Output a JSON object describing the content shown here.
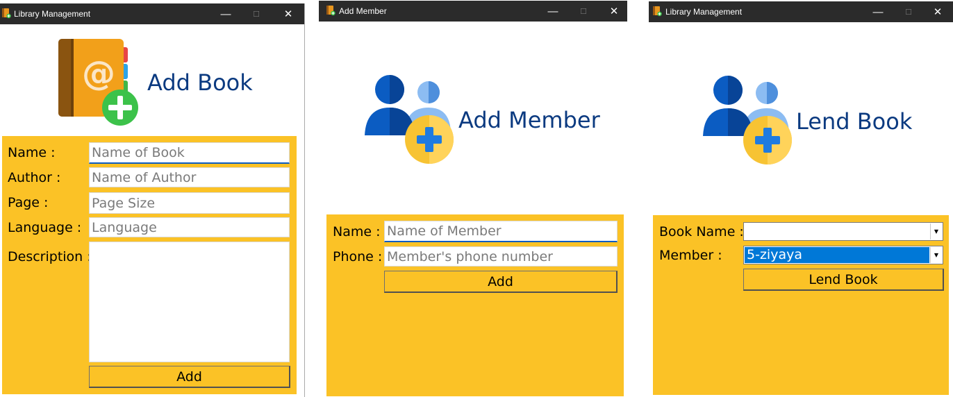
{
  "windows": {
    "add_book": {
      "title": "Library Management",
      "heading": "Add Book",
      "labels": {
        "name": "Name :",
        "author": "Author :",
        "page": "Page :",
        "language": "Language :",
        "description": "Description :"
      },
      "placeholders": {
        "name": "Name of Book",
        "author": "Name of Author",
        "page": "Page Size",
        "language": "Language"
      },
      "add_button": "Add"
    },
    "add_member": {
      "title": "Add Member",
      "heading": "Add Member",
      "labels": {
        "name": "Name :",
        "phone": "Phone :"
      },
      "placeholders": {
        "name": "Name of Member",
        "phone": "Member's phone number"
      },
      "add_button": "Add"
    },
    "lend_book": {
      "title": "Library Management",
      "heading": "Lend Book",
      "labels": {
        "book_name": "Book Name :",
        "member": "Member :"
      },
      "book_name_value": "",
      "member_value": "5-ziyaya",
      "lend_button": "Lend Book"
    }
  },
  "window_controls": {
    "minimize": "—",
    "maximize": "☐",
    "close": "✕"
  },
  "colors": {
    "panel": "#fbc226",
    "heading": "#0b3a80",
    "titlebar": "#2b2b2b",
    "selection": "#0078d7"
  },
  "icons": {
    "add_book": "address-book-add-icon",
    "add_member": "users-add-icon",
    "lend_book": "users-add-icon",
    "app": "app-icon"
  }
}
